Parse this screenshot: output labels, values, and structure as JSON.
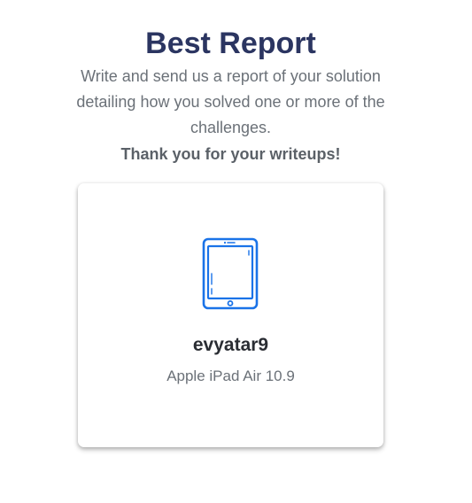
{
  "header": {
    "title": "Best Report",
    "description": "Write and send us a report of your solution detailing how you solved one or more of the challenges.",
    "thanks": "Thank you for your writeups!"
  },
  "card": {
    "icon": "tablet-icon",
    "winner": "evyatar9",
    "prize": "Apple iPad Air 10.9"
  },
  "colors": {
    "title": "#2b3561",
    "icon": "#1a73e8",
    "muted_text": "#6b7178"
  }
}
